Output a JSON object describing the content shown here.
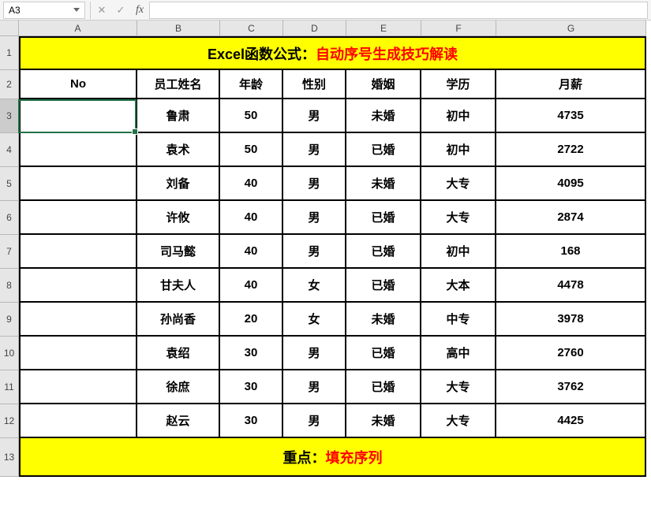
{
  "cellRef": "A3",
  "cols": [
    "A",
    "B",
    "C",
    "D",
    "E",
    "F",
    "G"
  ],
  "rowHeads": [
    "1",
    "2",
    "3",
    "4",
    "5",
    "6",
    "7",
    "8",
    "9",
    "10",
    "11",
    "12",
    "13"
  ],
  "titleBlack": "Excel函数公式：",
  "titleRed": "自动序号生成技巧解读",
  "headers": {
    "no": "No",
    "name": "员工姓名",
    "age": "年龄",
    "gender": "性别",
    "marriage": "婚姻",
    "edu": "学历",
    "salary": "月薪"
  },
  "rows": [
    {
      "no": "",
      "name": "鲁肃",
      "age": "50",
      "gender": "男",
      "marriage": "未婚",
      "edu": "初中",
      "salary": "4735"
    },
    {
      "no": "",
      "name": "袁术",
      "age": "50",
      "gender": "男",
      "marriage": "已婚",
      "edu": "初中",
      "salary": "2722"
    },
    {
      "no": "",
      "name": "刘备",
      "age": "40",
      "gender": "男",
      "marriage": "未婚",
      "edu": "大专",
      "salary": "4095"
    },
    {
      "no": "",
      "name": "许攸",
      "age": "40",
      "gender": "男",
      "marriage": "已婚",
      "edu": "大专",
      "salary": "2874"
    },
    {
      "no": "",
      "name": "司马懿",
      "age": "40",
      "gender": "男",
      "marriage": "已婚",
      "edu": "初中",
      "salary": "168"
    },
    {
      "no": "",
      "name": "甘夫人",
      "age": "40",
      "gender": "女",
      "marriage": "已婚",
      "edu": "大本",
      "salary": "4478"
    },
    {
      "no": "",
      "name": "孙尚香",
      "age": "20",
      "gender": "女",
      "marriage": "未婚",
      "edu": "中专",
      "salary": "3978"
    },
    {
      "no": "",
      "name": "袁绍",
      "age": "30",
      "gender": "男",
      "marriage": "已婚",
      "edu": "高中",
      "salary": "2760"
    },
    {
      "no": "",
      "name": "徐庶",
      "age": "30",
      "gender": "男",
      "marriage": "已婚",
      "edu": "大专",
      "salary": "3762"
    },
    {
      "no": "",
      "name": "赵云",
      "age": "30",
      "gender": "男",
      "marriage": "未婚",
      "edu": "大专",
      "salary": "4425"
    }
  ],
  "footerBlack": "重点：",
  "footerRed": "填充序列",
  "chart_data": {
    "type": "table",
    "title": "Excel函数公式：自动序号生成技巧解读",
    "columns": [
      "No",
      "员工姓名",
      "年龄",
      "性别",
      "婚姻",
      "学历",
      "月薪"
    ],
    "data": [
      [
        "",
        "鲁肃",
        50,
        "男",
        "未婚",
        "初中",
        4735
      ],
      [
        "",
        "袁术",
        50,
        "男",
        "已婚",
        "初中",
        2722
      ],
      [
        "",
        "刘备",
        40,
        "男",
        "未婚",
        "大专",
        4095
      ],
      [
        "",
        "许攸",
        40,
        "男",
        "已婚",
        "大专",
        2874
      ],
      [
        "",
        "司马懿",
        40,
        "男",
        "已婚",
        "初中",
        168
      ],
      [
        "",
        "甘夫人",
        40,
        "女",
        "已婚",
        "大本",
        4478
      ],
      [
        "",
        "孙尚香",
        20,
        "女",
        "未婚",
        "中专",
        3978
      ],
      [
        "",
        "袁绍",
        30,
        "男",
        "已婚",
        "高中",
        2760
      ],
      [
        "",
        "徐庶",
        30,
        "男",
        "已婚",
        "大专",
        3762
      ],
      [
        "",
        "赵云",
        30,
        "男",
        "未婚",
        "大专",
        4425
      ]
    ]
  }
}
